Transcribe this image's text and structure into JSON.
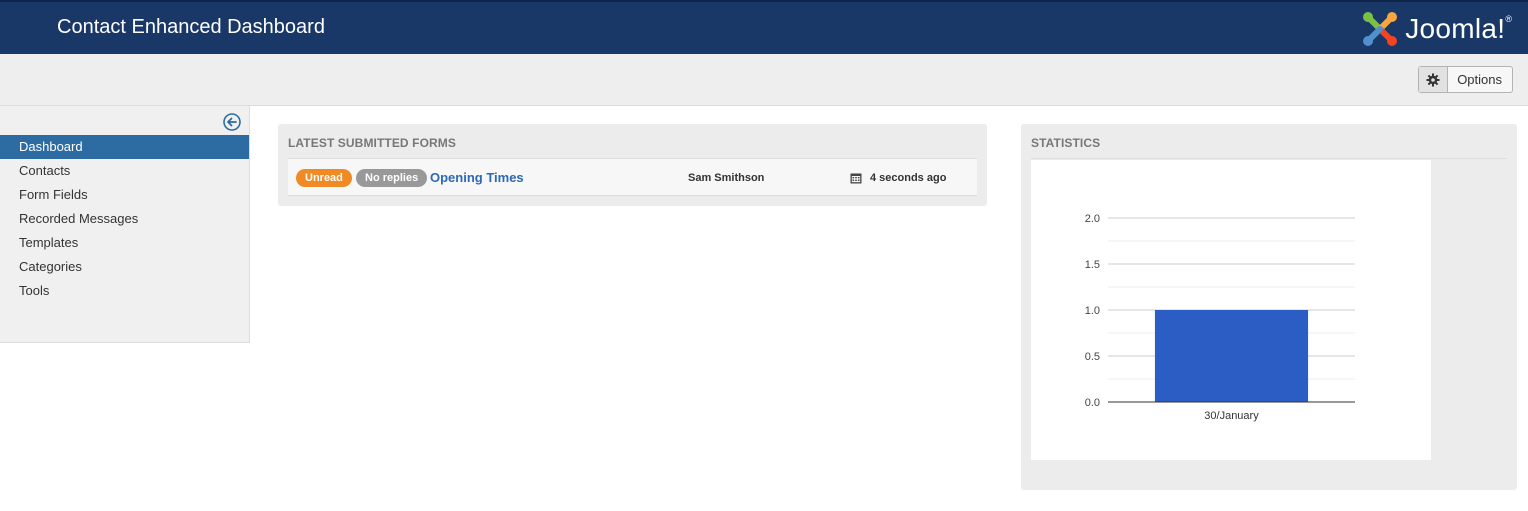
{
  "header": {
    "title": "Contact Enhanced Dashboard",
    "logo_text": "Joomla!"
  },
  "toolbar": {
    "options_label": "Options",
    "options_icon": "gear-icon"
  },
  "sidebar": {
    "collapse_icon": "arrow-left-circle-icon",
    "items": [
      {
        "label": "Dashboard",
        "active": true
      },
      {
        "label": "Contacts",
        "active": false
      },
      {
        "label": "Form Fields",
        "active": false
      },
      {
        "label": "Recorded Messages",
        "active": false
      },
      {
        "label": "Templates",
        "active": false
      },
      {
        "label": "Categories",
        "active": false
      },
      {
        "label": "Tools",
        "active": false
      }
    ]
  },
  "latest_forms": {
    "heading": "LATEST SUBMITTED FORMS",
    "rows": [
      {
        "status_badge": "Unread",
        "reply_badge": "No replies",
        "subject": "Opening Times",
        "sender": "Sam Smithson",
        "time": "4 seconds ago"
      }
    ]
  },
  "statistics": {
    "heading": "STATISTICS"
  },
  "chart_data": {
    "type": "bar",
    "categories": [
      "30/January"
    ],
    "values": [
      1.0
    ],
    "title": "",
    "xlabel": "",
    "ylabel": "",
    "ylim": [
      0,
      2
    ],
    "yticks": [
      "0.0",
      "0.5",
      "1.0",
      "1.5",
      "2.0"
    ],
    "grid": true,
    "bar_color": "#2b5dc4"
  },
  "colors": {
    "header_bg": "#1a3867",
    "active_nav": "#2d6ca2",
    "unread_badge": "#f08a24",
    "noreply_badge": "#999999",
    "link": "#2a69b8"
  }
}
